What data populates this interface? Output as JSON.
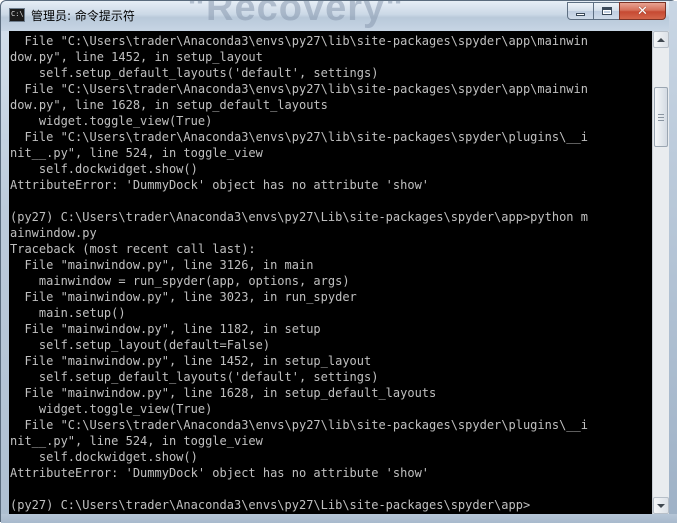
{
  "window": {
    "title": "管理员: 命令提示符",
    "icon": "console-app-icon",
    "icon_text": "C:\\",
    "background_word": "\"Recovery\"",
    "controls": {
      "minimize": "minimize-icon",
      "maximize": "maximize-icon",
      "close": "close-icon",
      "close_glyph": "✕"
    }
  },
  "console": {
    "colors": {
      "background": "#000000",
      "foreground": "#c0c0c0"
    },
    "lines": [
      "  File \"C:\\Users\\trader\\Anaconda3\\envs\\py27\\lib\\site-packages\\spyder\\app\\mainwin",
      "dow.py\", line 1452, in setup_layout",
      "    self.setup_default_layouts('default', settings)",
      "  File \"C:\\Users\\trader\\Anaconda3\\envs\\py27\\lib\\site-packages\\spyder\\app\\mainwin",
      "dow.py\", line 1628, in setup_default_layouts",
      "    widget.toggle_view(True)",
      "  File \"C:\\Users\\trader\\Anaconda3\\envs\\py27\\lib\\site-packages\\spyder\\plugins\\__i",
      "nit__.py\", line 524, in toggle_view",
      "    self.dockwidget.show()",
      "AttributeError: 'DummyDock' object has no attribute 'show'",
      "",
      "(py27) C:\\Users\\trader\\Anaconda3\\envs\\py27\\Lib\\site-packages\\spyder\\app>python m",
      "ainwindow.py",
      "Traceback (most recent call last):",
      "  File \"mainwindow.py\", line 3126, in main",
      "    mainwindow = run_spyder(app, options, args)",
      "  File \"mainwindow.py\", line 3023, in run_spyder",
      "    main.setup()",
      "  File \"mainwindow.py\", line 1182, in setup",
      "    self.setup_layout(default=False)",
      "  File \"mainwindow.py\", line 1452, in setup_layout",
      "    self.setup_default_layouts('default', settings)",
      "  File \"mainwindow.py\", line 1628, in setup_default_layouts",
      "    widget.toggle_view(True)",
      "  File \"C:\\Users\\trader\\Anaconda3\\envs\\py27\\lib\\site-packages\\spyder\\plugins\\__i",
      "nit__.py\", line 524, in toggle_view",
      "    self.dockwidget.show()",
      "AttributeError: 'DummyDock' object has no attribute 'show'",
      "",
      "(py27) C:\\Users\\trader\\Anaconda3\\envs\\py27\\Lib\\site-packages\\spyder\\app>"
    ]
  },
  "scrollbar": {
    "up_icon": "scroll-up-arrow-icon",
    "down_icon": "scroll-down-arrow-icon",
    "position_fraction": 0.1
  }
}
